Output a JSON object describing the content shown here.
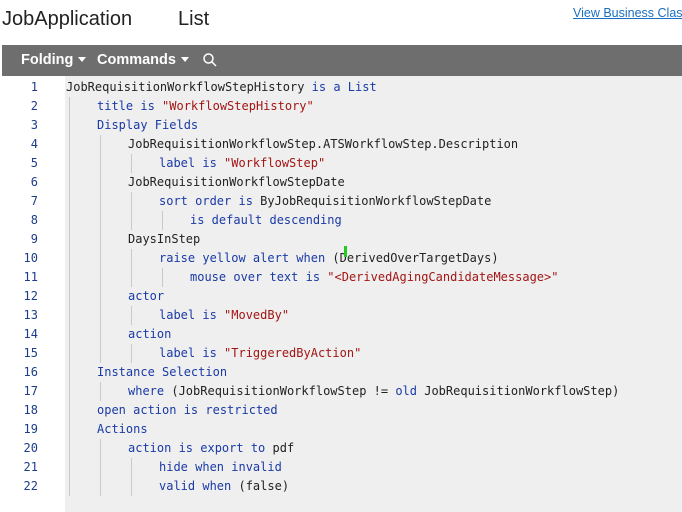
{
  "header": {
    "title_left": "JobApplication",
    "title_right": "List",
    "view_link": "View Business Clas"
  },
  "toolbar": {
    "folding_label": "Folding",
    "commands_label": "Commands",
    "search_icon": "search-icon"
  },
  "colors": {
    "keyword": "#1a3aa6",
    "string": "#a31515",
    "toolbar_bg": "#6e6e6e",
    "code_bg": "#efefef",
    "link": "#1a6fc0",
    "cursor": "#22cc22"
  },
  "code_lines": [
    {
      "n": "1",
      "indent": 0,
      "tokens": [
        {
          "t": "JobRequisitionWorkflowStepHistory",
          "c": "id"
        },
        {
          "t": " is a List",
          "c": "kw"
        }
      ]
    },
    {
      "n": "2",
      "indent": 1,
      "tokens": [
        {
          "t": "title is ",
          "c": "kw"
        },
        {
          "t": "\"WorkflowStepHistory\"",
          "c": "str"
        }
      ]
    },
    {
      "n": "3",
      "indent": 1,
      "tokens": [
        {
          "t": "Display Fields",
          "c": "kw"
        }
      ]
    },
    {
      "n": "4",
      "indent": 2,
      "tokens": [
        {
          "t": "JobRequisitionWorkflowStep.ATSWorkflowStep.Description",
          "c": "id"
        }
      ]
    },
    {
      "n": "5",
      "indent": 3,
      "tokens": [
        {
          "t": "label is ",
          "c": "kw"
        },
        {
          "t": "\"WorkflowStep\"",
          "c": "str"
        }
      ]
    },
    {
      "n": "6",
      "indent": 2,
      "tokens": [
        {
          "t": "JobRequisitionWorkflowStepDate",
          "c": "id"
        }
      ]
    },
    {
      "n": "7",
      "indent": 3,
      "tokens": [
        {
          "t": "sort order is ",
          "c": "kw"
        },
        {
          "t": "ByJobRequisitionWorkflowStepDate",
          "c": "id"
        }
      ]
    },
    {
      "n": "8",
      "indent": 4,
      "tokens": [
        {
          "t": "is default descending",
          "c": "kw"
        }
      ]
    },
    {
      "n": "9",
      "indent": 2,
      "tokens": [
        {
          "t": "DaysInStep",
          "c": "id"
        }
      ]
    },
    {
      "n": "10",
      "indent": 3,
      "tokens": [
        {
          "t": "raise yellow alert when ",
          "c": "kw"
        },
        {
          "t": "(DerivedOverTargetDays)",
          "c": "id"
        }
      ]
    },
    {
      "n": "11",
      "indent": 4,
      "tokens": [
        {
          "t": "mouse over text is ",
          "c": "kw"
        },
        {
          "t": "\"<DerivedAgingCandidateMessage>\"",
          "c": "str"
        }
      ]
    },
    {
      "n": "12",
      "indent": 2,
      "tokens": [
        {
          "t": "actor",
          "c": "kw"
        }
      ]
    },
    {
      "n": "13",
      "indent": 3,
      "tokens": [
        {
          "t": "label is ",
          "c": "kw"
        },
        {
          "t": "\"MovedBy\"",
          "c": "str"
        }
      ]
    },
    {
      "n": "14",
      "indent": 2,
      "tokens": [
        {
          "t": "action",
          "c": "kw"
        }
      ]
    },
    {
      "n": "15",
      "indent": 3,
      "tokens": [
        {
          "t": "label is ",
          "c": "kw"
        },
        {
          "t": "\"TriggeredByAction\"",
          "c": "str"
        }
      ]
    },
    {
      "n": "16",
      "indent": 1,
      "tokens": [
        {
          "t": "Instance Selection",
          "c": "kw"
        }
      ]
    },
    {
      "n": "17",
      "indent": 2,
      "tokens": [
        {
          "t": "where ",
          "c": "kw"
        },
        {
          "t": "(JobRequisitionWorkflowStep != ",
          "c": "id"
        },
        {
          "t": "old ",
          "c": "kw"
        },
        {
          "t": "JobRequisitionWorkflowStep)",
          "c": "id"
        }
      ]
    },
    {
      "n": "18",
      "indent": 1,
      "tokens": [
        {
          "t": "open action is restricted",
          "c": "kw"
        }
      ]
    },
    {
      "n": "19",
      "indent": 1,
      "tokens": [
        {
          "t": "Actions",
          "c": "kw"
        }
      ]
    },
    {
      "n": "20",
      "indent": 2,
      "tokens": [
        {
          "t": "action is export to ",
          "c": "kw"
        },
        {
          "t": "pdf",
          "c": "id"
        }
      ]
    },
    {
      "n": "21",
      "indent": 3,
      "tokens": [
        {
          "t": "hide when invalid",
          "c": "kw"
        }
      ]
    },
    {
      "n": "22",
      "indent": 3,
      "tokens": [
        {
          "t": "valid when ",
          "c": "kw"
        },
        {
          "t": "(false)",
          "c": "id"
        }
      ]
    }
  ]
}
